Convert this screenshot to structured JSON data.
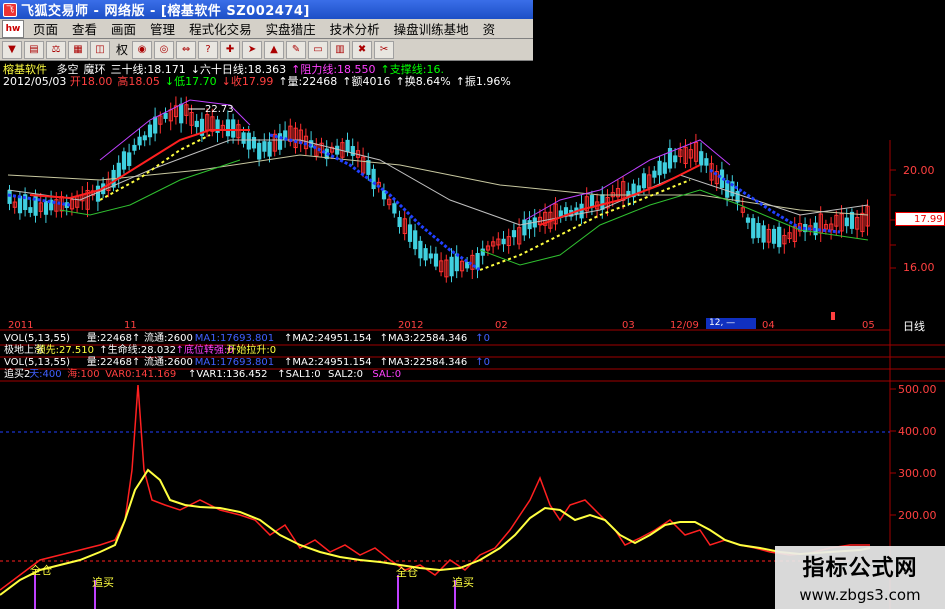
{
  "window": {
    "title": "飞狐交易师 - 网络版 - [榕基软件 SZ002474]",
    "app_icon": "app-logo-icon"
  },
  "menu": {
    "logo": "hw",
    "items": [
      "页面",
      "查看",
      "画面",
      "管理",
      "程式化交易",
      "实盘猎庄",
      "技术分析",
      "操盘训练基地",
      "资"
    ]
  },
  "toolbar": {
    "buttons": [
      "arrow-down-icon",
      "chart-icon",
      "scale-icon",
      "grid-icon",
      "split-icon",
      "pill-icon",
      "target-icon",
      "left-right-icon",
      "help-icon",
      "cross-icon",
      "arrow-icon",
      "up-icon",
      "pencil-icon",
      "monitor-icon",
      "columns-icon",
      "close-icon",
      "scissors-icon"
    ],
    "quan_label": "权"
  },
  "stock_line": {
    "name": "榕基软件",
    "items": [
      {
        "text": "多空",
        "color": "#ffffff"
      },
      {
        "text": "魔环",
        "color": "#ffffff"
      },
      {
        "text": "三十线:18.171",
        "color": "#ffffff"
      },
      {
        "text": "↓六十日线:18.363",
        "color": "#ffffff"
      },
      {
        "text": "↑阻力线:18.550",
        "color": "#ff40ff"
      },
      {
        "text": "↑支撑线:16.",
        "color": "#00ff00"
      }
    ]
  },
  "date_line": {
    "date": "2012/05/03",
    "items": [
      {
        "text": "开18.00",
        "color": "#ff4040"
      },
      {
        "text": "高18.05",
        "color": "#ff4040"
      },
      {
        "text": "↓低17.70",
        "color": "#00ff00"
      },
      {
        "text": "↓收17.99",
        "color": "#ff4040"
      },
      {
        "text": "↑量:22468",
        "color": "#ffffff"
      },
      {
        "text": "↑额4016",
        "color": "#ffffff"
      },
      {
        "text": "↑换8.64%",
        "color": "#ffffff"
      },
      {
        "text": "↑振1.96%",
        "color": "#ffffff"
      }
    ]
  },
  "price_axis": {
    "labels": [
      "20.00",
      "16.00"
    ],
    "current_price": "17.99",
    "max_label": "22.73"
  },
  "time_axis": {
    "labels": [
      "2011",
      "11",
      "2012",
      "02",
      "03",
      "12/09",
      "04",
      "05"
    ],
    "period": "日线",
    "highlight": "12, —"
  },
  "indicator_lines": [
    [
      {
        "text": "VOL(5,13,55)",
        "color": "#ffffff"
      },
      {
        "text": "量:22468↑",
        "color": "#ffffff"
      },
      {
        "text": "流通:2600",
        "color": "#ffffff"
      },
      {
        "text": "MA1:17693.801",
        "color": "#4060ff"
      },
      {
        "text": "↑MA2:24951.154",
        "color": "#ffffff"
      },
      {
        "text": "↑MA3:22584.346",
        "color": "#ffffff"
      },
      {
        "text": "↑0",
        "color": "#4060ff"
      }
    ],
    [
      {
        "text": "极地上涨",
        "color": "#ffffff"
      },
      {
        "text": "领先:27.510",
        "color": "#ffff40"
      },
      {
        "text": "↑生命线:28.032",
        "color": "#ffffff"
      },
      {
        "text": "↑底位转强:0",
        "color": "#ff40ff"
      },
      {
        "text": "开始拉升:0",
        "color": "#ffff40"
      }
    ],
    [
      {
        "text": "VOL(5,13,55)",
        "color": "#ffffff"
      },
      {
        "text": "量:22468↑",
        "color": "#ffffff"
      },
      {
        "text": "流通:2600",
        "color": "#ffffff"
      },
      {
        "text": "MA1:17693.801",
        "color": "#4060ff"
      },
      {
        "text": "↑MA2:24951.154",
        "color": "#ffffff"
      },
      {
        "text": "↑MA3:22584.346",
        "color": "#ffffff"
      },
      {
        "text": "↑0",
        "color": "#4060ff"
      }
    ],
    [
      {
        "text": "追买2",
        "color": "#ffffff"
      },
      {
        "text": "天:400",
        "color": "#4060ff"
      },
      {
        "text": "海:100",
        "color": "#ff4040"
      },
      {
        "text": "VAR0:141.169",
        "color": "#ff4040"
      },
      {
        "text": "↑VAR1:136.452",
        "color": "#ffffff"
      },
      {
        "text": "↑SAL1:0",
        "color": "#ffffff"
      },
      {
        "text": "SAL2:0",
        "color": "#ffffff"
      },
      {
        "text": "SAL:0",
        "color": "#ff40ff"
      }
    ]
  ],
  "indicator_axis": {
    "labels": [
      "500.00",
      "400.00",
      "300.00",
      "200.00"
    ]
  },
  "signals": [
    "全仓",
    "追买",
    "全仓",
    "追买"
  ],
  "watermark": {
    "title": "指标公式网",
    "url": "www.zbgs3.com"
  },
  "colors": {
    "up": "#ff3030",
    "down": "#40d0e0",
    "grid": "#a00000",
    "indicator_red": "#ff2020",
    "indicator_yellow": "#ffff40"
  }
}
